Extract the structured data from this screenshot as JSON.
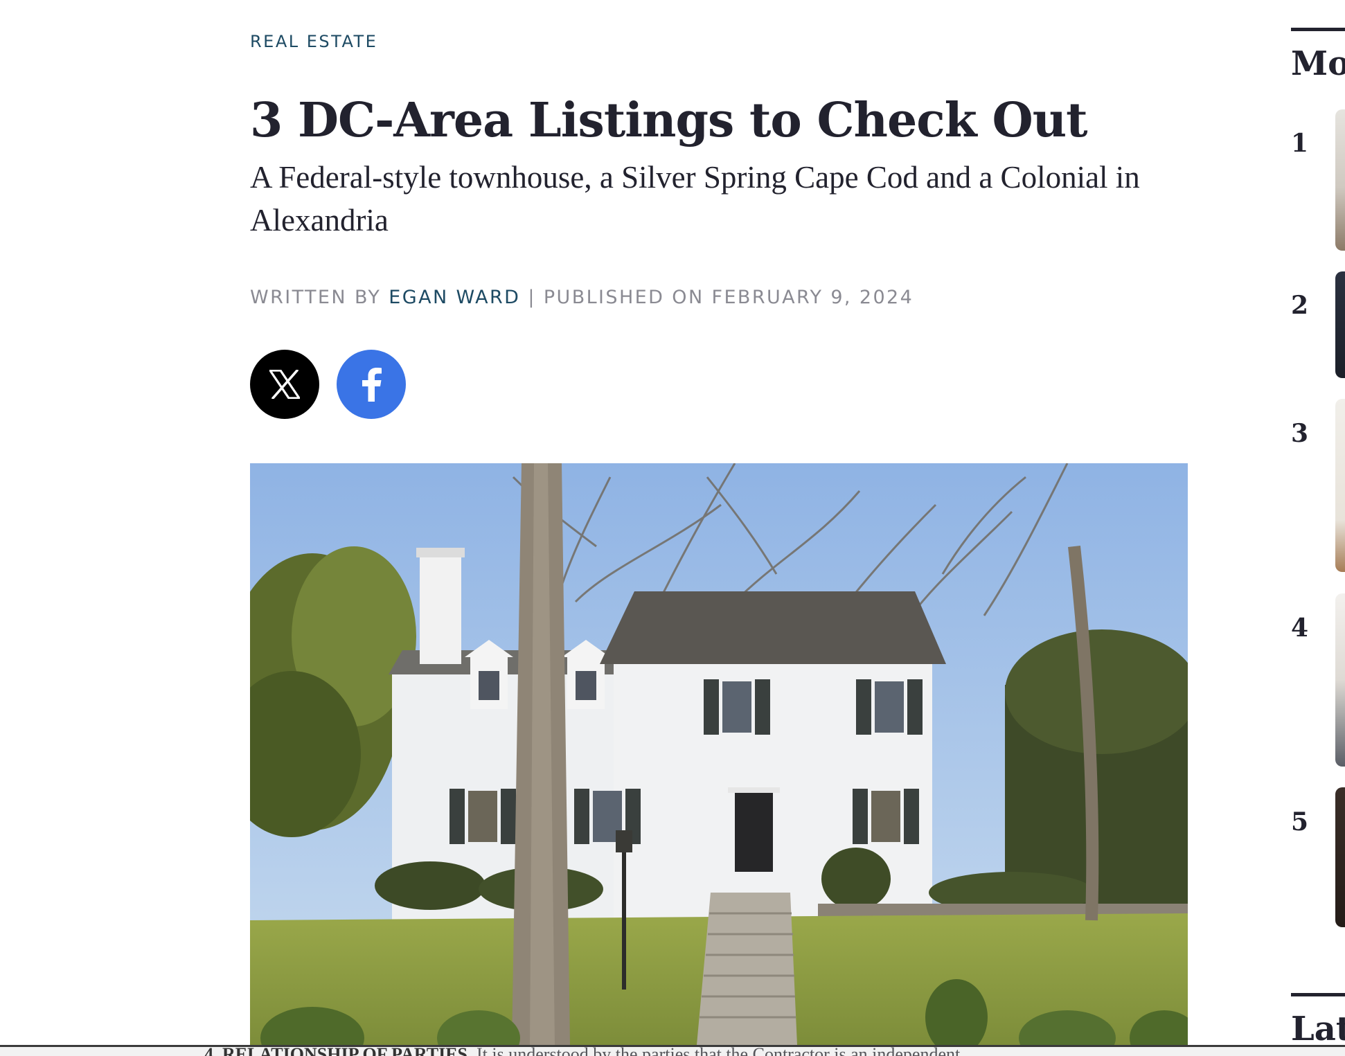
{
  "article": {
    "category": "REAL ESTATE",
    "headline": "3 DC-Area Listings to Check Out",
    "dek": "A Federal-style townhouse, a Silver Spring Cape Cod and a Colonial in Alexandria",
    "byline": {
      "written_by_label": "WRITTEN BY",
      "author": "EGAN WARD",
      "separator": "|",
      "published_label": "PUBLISHED ON",
      "date": "FEBRUARY 9, 2024"
    },
    "share": {
      "x_icon": "x-logo-icon",
      "facebook_icon": "facebook-logo-icon",
      "x_color": "#000000",
      "facebook_color": "#3a74e6"
    },
    "hero_image": "white-colonial-house-photo"
  },
  "sidebar": {
    "most_popular_heading": "Mo",
    "latest_heading": "Lat",
    "items": [
      {
        "rank": "1"
      },
      {
        "rank": "2"
      },
      {
        "rank": "3"
      },
      {
        "rank": "4"
      },
      {
        "rank": "5"
      }
    ]
  },
  "bottom_overlay": {
    "bold_text": "4. RELATIONSHIP OF PARTIES.",
    "text": " It is understood by the parties that the Contractor is an independent"
  },
  "colors": {
    "accent": "#1d4a63",
    "headline": "#22222e",
    "meta": "#8a8a92"
  }
}
